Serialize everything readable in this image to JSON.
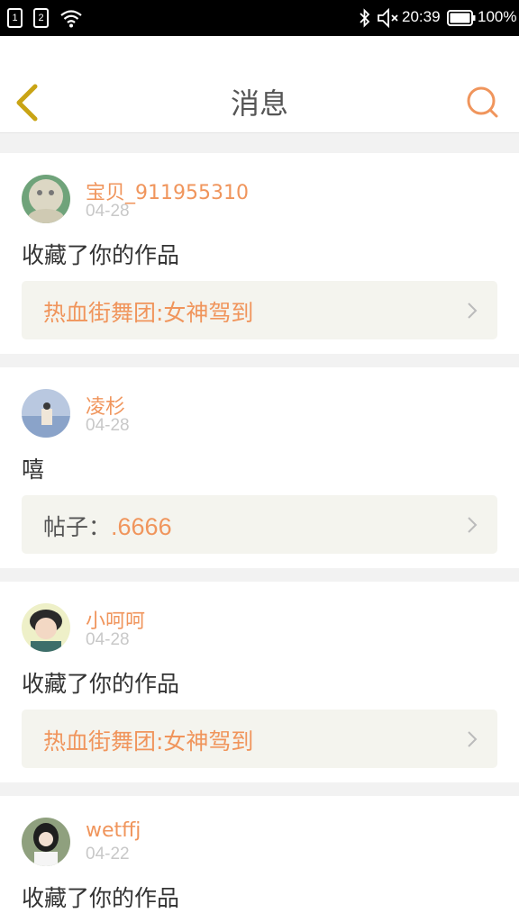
{
  "status_bar": {
    "sim1": "1",
    "sim2": "2",
    "time": "20:39",
    "battery": "100%",
    "icons": [
      "wifi-icon",
      "bluetooth-icon",
      "mute-icon",
      "battery-icon"
    ]
  },
  "header": {
    "title": "消息",
    "back_icon": "chevron-left-icon",
    "search_icon": "search-icon"
  },
  "colors": {
    "accent": "#f0955c",
    "back_icon": "#c9a415",
    "link_box": "#f4f4ee"
  },
  "messages": [
    {
      "username": "宝贝_911955310",
      "date": "04-28",
      "text": "收藏了你的作品",
      "link_prefix": "",
      "link_value": "热血街舞团:女神驾到"
    },
    {
      "username": "凌杉",
      "date": "04-28",
      "text": "嘻",
      "link_prefix": "帖子：",
      "link_value": ".6666"
    },
    {
      "username": "小呵呵",
      "date": "04-28",
      "text": "收藏了你的作品",
      "link_prefix": "",
      "link_value": "热血街舞团:女神驾到"
    },
    {
      "username": "wetffj",
      "date": "04-22",
      "text": "收藏了你的作品"
    }
  ]
}
